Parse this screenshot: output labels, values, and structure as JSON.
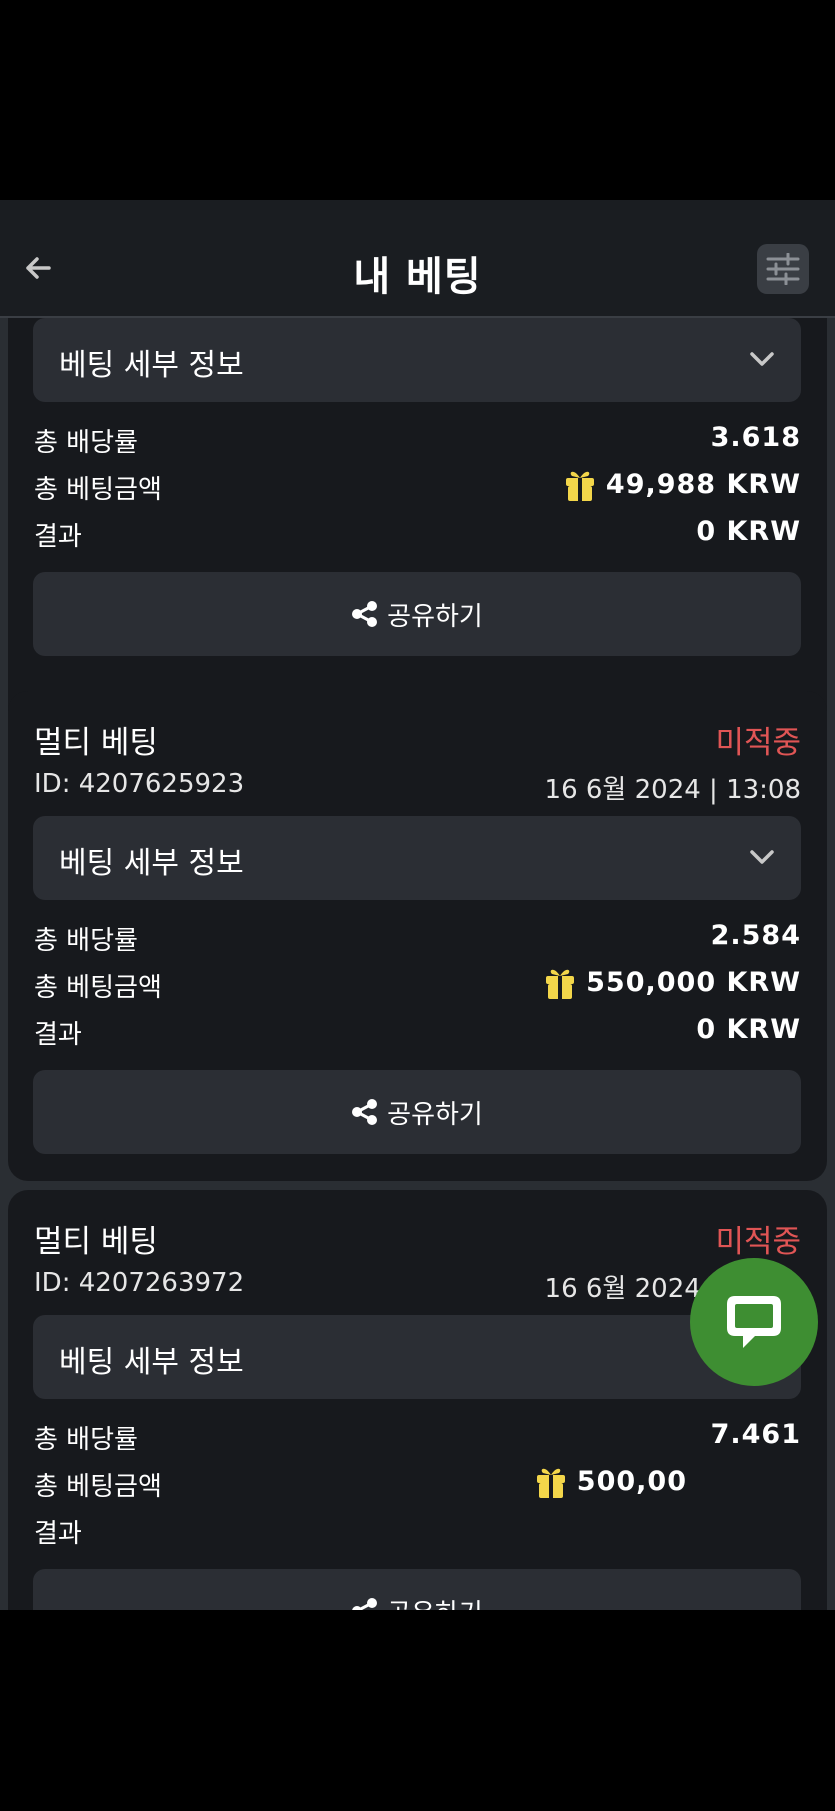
{
  "header": {
    "title": "내 베팅",
    "back_icon": "arrow-left-icon",
    "filter_icon": "sliders-icon"
  },
  "labels": {
    "details": "베팅 세부 정보",
    "total_odds": "총 배당률",
    "total_stake": "총 베팅금액",
    "result": "결과",
    "share": "공유하기"
  },
  "colors": {
    "status": "#e05555",
    "gift": "#f3d64a",
    "chat": "#3e8e32"
  },
  "cards": [
    {
      "total_odds": "3.618",
      "total_stake": "49,988 KRW",
      "result": "0 KRW"
    },
    {
      "type": "멀티 베팅",
      "status": "미적중",
      "bet_id": "ID: 4207625923",
      "date": "16 6월 2024 | 13:08",
      "total_odds": "2.584",
      "total_stake": "550,000 KRW",
      "result": "0 KRW"
    },
    {
      "type": "멀티 베팅",
      "status": "미적중",
      "bet_id": "ID: 4207263972",
      "date": "16 6월 2024 | 08:15",
      "total_odds": "7.461",
      "total_stake": "500,00",
      "result": ""
    }
  ],
  "chat_icon": "chat-bubble-icon"
}
